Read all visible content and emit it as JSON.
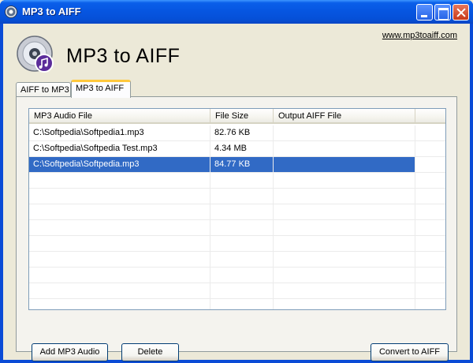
{
  "window": {
    "title": "MP3 to AIFF",
    "titlebar_color": "#0a5fea",
    "controls": {
      "minimize_icon": "minimize-icon",
      "maximize_icon": "maximize-icon",
      "close_icon": "close-icon"
    }
  },
  "header": {
    "app_title": "MP3 to AIFF",
    "website": "www.mp3toaiff.com",
    "logo_icon": "cd-music-icon"
  },
  "tabs": [
    {
      "label": "AIFF to MP3",
      "active": false
    },
    {
      "label": "MP3 to AIFF",
      "active": true
    }
  ],
  "file_list": {
    "columns": [
      "MP3 Audio File",
      "File Size",
      "Output AIFF File",
      ""
    ],
    "rows": [
      {
        "file": "C:\\Softpedia\\Softpedia1.mp3",
        "size": "82.76 KB",
        "output": "",
        "selected": false
      },
      {
        "file": "C:\\Softpedia\\Softpedia Test.mp3",
        "size": "4.34 MB",
        "output": "",
        "selected": false
      },
      {
        "file": "C:\\Softpedia\\Softpedia.mp3",
        "size": "84.77 KB",
        "output": "",
        "selected": true
      }
    ],
    "selection_color": "#316ac5"
  },
  "buttons": {
    "add": "Add MP3 Audio",
    "delete": "Delete",
    "convert": "Convert to AIFF"
  }
}
